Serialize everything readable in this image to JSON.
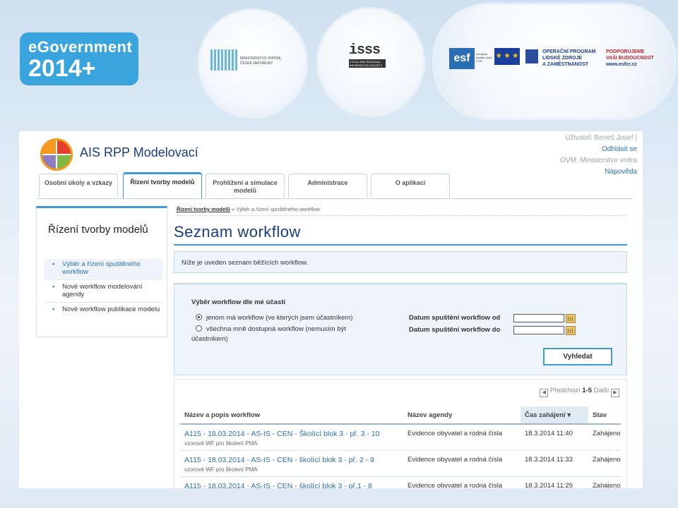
{
  "banner": {
    "egov_line1": "eGovernment",
    "egov_line2": "2014+",
    "mv_text": "MINISTERSTVO VNITRA ČESKÉ REPUBLIKY",
    "isss_text": "isss",
    "isss_sub": "LOCAL AND REGIONAL INFORMATION SOCIETY",
    "esf_text": "esf",
    "esf_sub": "evropský sociální fond v ČR",
    "op_line1": "OPERAČNÍ PROGRAM",
    "op_line2": "LIDSKÉ ZDROJE",
    "op_line3": "A ZAMĚSTNANOST",
    "pod_line1": "PODPORUJEME",
    "pod_line2": "VAŠI BUDOUCNOST",
    "pod_line3": "www.esfcr.cz"
  },
  "header": {
    "app_title": "AIS RPP Modelovací",
    "user_label": "Uživatel: Beneš Josef",
    "user_sep": "|",
    "logout": "Odhlásit se",
    "ovm_label": "OVM:",
    "ovm_value": "Ministerstvo vnitra",
    "help": "Nápověda"
  },
  "tabs": [
    {
      "label": "Osobní úkoly a vzkazy"
    },
    {
      "label": "Řízení tvorby modelů"
    },
    {
      "label": "Prohlížení a simulace modelů"
    },
    {
      "label": "Administrace"
    },
    {
      "label": "O aplikaci"
    }
  ],
  "sidebar": {
    "title": "Řízení tvorby modelů",
    "items": [
      {
        "label": "Výběr a řízení spuštěného workflow"
      },
      {
        "label": "Nové workflow modelování agendy"
      },
      {
        "label": "Nové workflow publikace modelu"
      }
    ]
  },
  "breadcrumb": {
    "root": "Řízení tvorby modelů",
    "separator": "»",
    "current": "Výběr a řízení spuštěného workflow"
  },
  "main": {
    "title": "Seznam workflow",
    "info": "Níže je uveden seznam běžících workflow."
  },
  "filter": {
    "heading": "Výběr workflow dle mé účasti",
    "option1": "jenom má workflow (ve kterých jsem účastníkem)",
    "option2_line1": "všechna mně dostupná workflow (nemusím být",
    "option2_line2": "účastníkem)",
    "date_from_label": "Datum spuštění workflow od",
    "date_to_label": "Datum spuštění workflow do",
    "date_from_value": "",
    "date_to_value": "",
    "search_button": "Vyhledat"
  },
  "pager": {
    "prev": "Předchozí",
    "range": "1-5",
    "next": "Další"
  },
  "table": {
    "columns": [
      "Název a popis workflow",
      "Název agendy",
      "Čas zahájení",
      "Stav"
    ],
    "sort_indicator": "▾",
    "rows": [
      {
        "name": "A115 - 18.03.2014 - AS-IS - CEN - Školící blok 3 - př. 3 - 10",
        "desc": "vzorové WF pro školení PMA",
        "agenda": "Evidence obyvatel a rodná čísla",
        "time": "18.3.2014 11:40",
        "status": "Zahájeno"
      },
      {
        "name": "A115 - 18.03.2014 - AS-IS - CEN - školící blok 3 - př. 2 - 9",
        "desc": "vzorové WF pro školení PMA",
        "agenda": "Evidence obyvatel a rodná čísla",
        "time": "18.3.2014 11:33",
        "status": "Zahájeno"
      },
      {
        "name": "A115 - 18.03.2014 - AS-IS - CEN - školící blok 3 - př.1 - 8",
        "desc": "",
        "agenda": "Evidence obyvatel a rodná čísla",
        "time": "18.3.2014 11:29",
        "status": "Zahájeno"
      }
    ]
  }
}
